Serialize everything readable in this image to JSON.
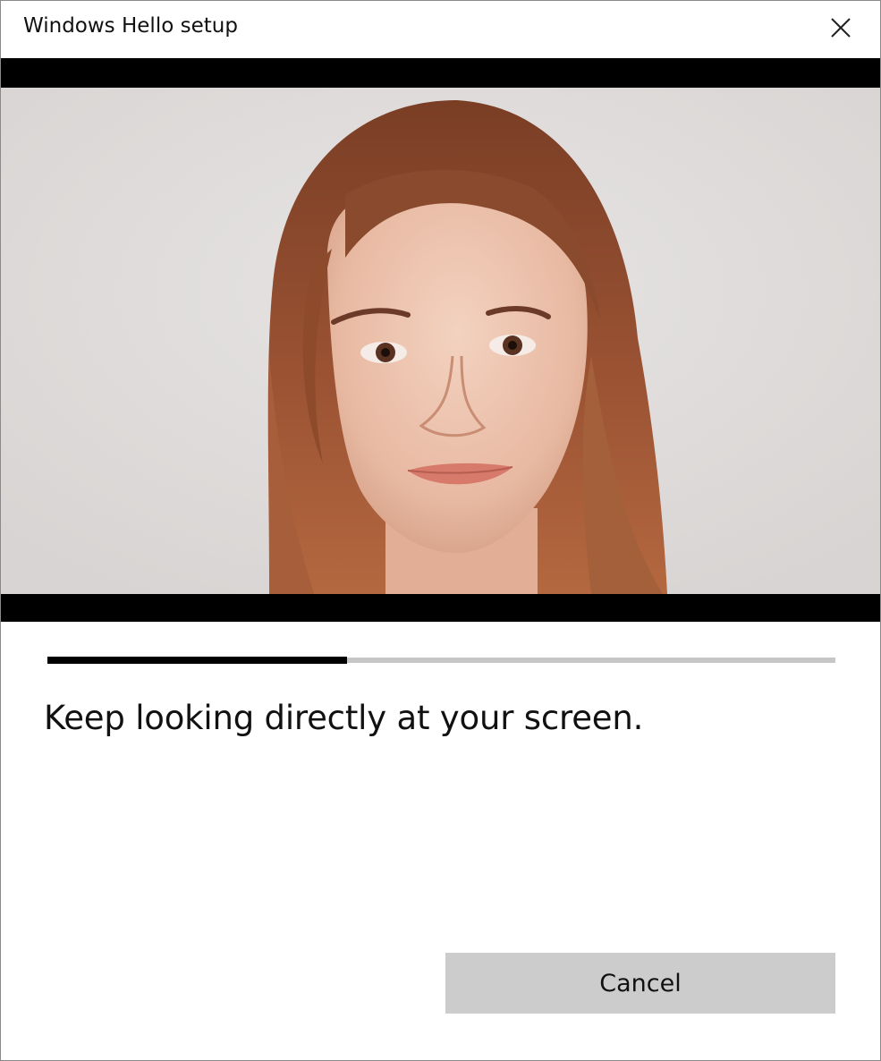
{
  "window": {
    "title": "Windows Hello setup"
  },
  "camera": {
    "description_icon": "face-preview"
  },
  "progress": {
    "fraction": 0.38
  },
  "instruction": "Keep looking directly at your screen.",
  "actions": {
    "cancel_label": "Cancel"
  },
  "icons": {
    "close": "close-icon"
  },
  "colors": {
    "progress_fill": "#000000",
    "progress_track": "#c6c6c6",
    "button_bg": "#cccccc"
  }
}
